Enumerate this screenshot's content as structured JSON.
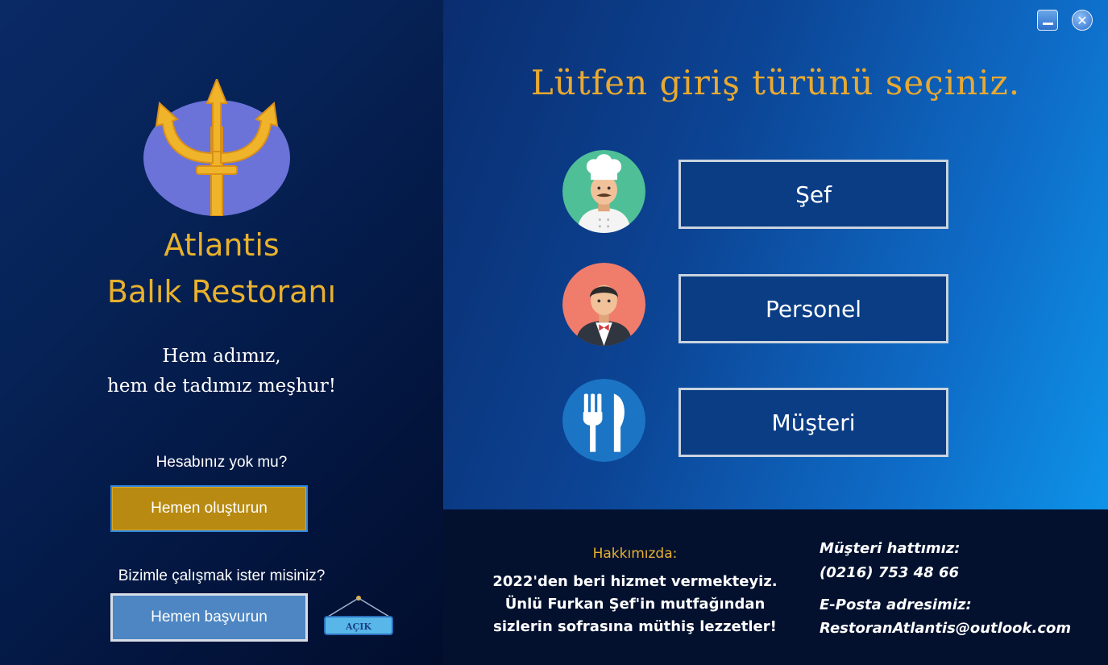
{
  "brand": {
    "line1": "Atlantis",
    "line2": "Balık Restoranı"
  },
  "slogan": {
    "line1": "Hem  adımız,",
    "line2": "hem de tadımız meşhur!"
  },
  "signup": {
    "question": "Hesabınız yok mu?",
    "button": "Hemen oluşturun"
  },
  "career": {
    "question": "Bizimle çalışmak ister misiniz?",
    "button": "Hemen başvurun"
  },
  "open_sign": {
    "label": "AÇIK"
  },
  "login": {
    "title": "Lütfen giriş türünü seçiniz.",
    "options": [
      {
        "label": "Şef",
        "icon": "chef-icon"
      },
      {
        "label": "Personel",
        "icon": "waiter-icon"
      },
      {
        "label": "Müşteri",
        "icon": "fork-knife-icon"
      }
    ]
  },
  "window_controls": {
    "minimize_icon": "minimize-icon",
    "close_icon": "close-icon",
    "close_glyph": "✕"
  },
  "about": {
    "title": "Hakkımızda:",
    "lines": [
      "2022'den beri hizmet vermekteyiz.",
      "Ünlü Furkan Şef'in mutfağından",
      "sizlerin sofrasına müthiş lezzetler!"
    ]
  },
  "contact": {
    "phone_label": "Müşteri hattımız:",
    "phone": "(0216) 753 48 66",
    "email_label": "E-Posta adresimiz:",
    "email": "RestoranAtlantis@outlook.com"
  },
  "colors": {
    "gold": "#e8b12d",
    "left_bg": "#062256",
    "right_bg": "#0c4596",
    "footer_bg": "#03112f",
    "button_bg": "#0a3d84",
    "create_button": "#b88a12",
    "apply_button": "#4d86c2"
  }
}
